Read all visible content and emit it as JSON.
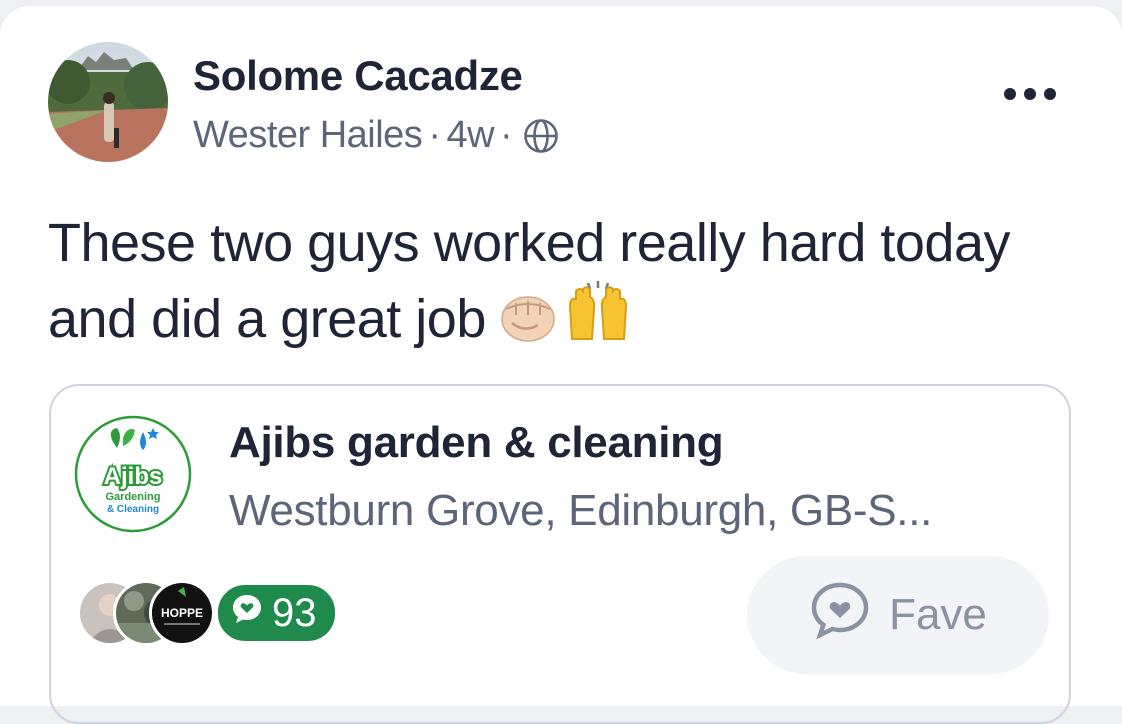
{
  "post": {
    "author": "Solome Cacadze",
    "location": "Wester Hailes",
    "separator": "·",
    "time": "4w",
    "visibility_icon": "globe-icon",
    "more_icon": "more-options-icon",
    "text": "These two guys worked really hard today and did a great job",
    "emojis": [
      "raised-fist",
      "raising-hands"
    ]
  },
  "business": {
    "name": "Ajibs garden & cleaning",
    "address": "Westburn Grove, Edinburgh,  GB-S...",
    "logo": {
      "brand": "Ajibs",
      "line1": "Gardening",
      "line2": "& Cleaning",
      "green": "#2d9b3a",
      "blue": "#1e88d6"
    },
    "fave_avatar_text": "HOPPE",
    "fave_count": "93",
    "fave_label": "Fave"
  },
  "colors": {
    "text": "#1f2537",
    "muted": "#5d6579",
    "badge_green": "#1f8a4b"
  }
}
